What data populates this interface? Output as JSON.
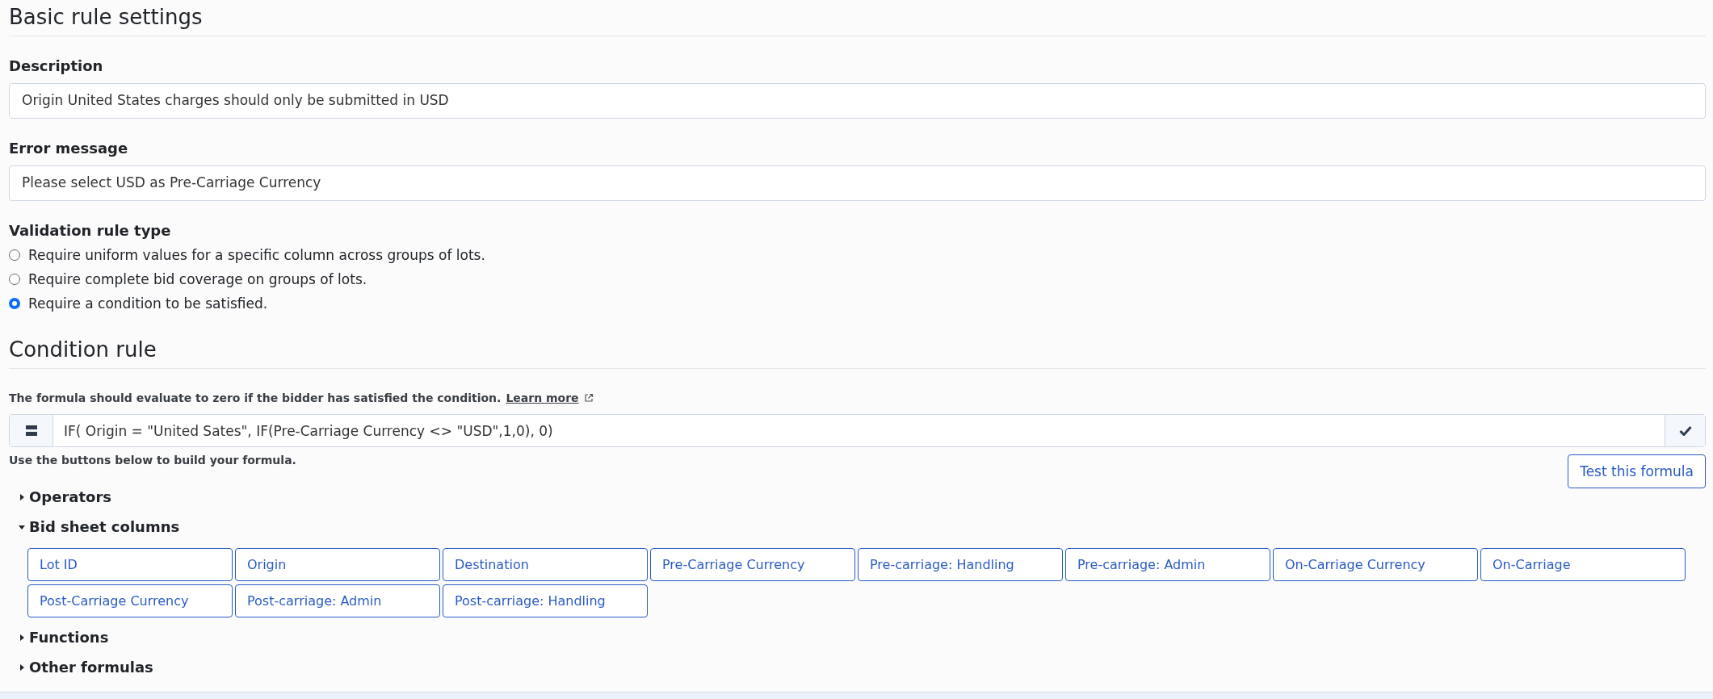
{
  "basic_settings": {
    "title": "Basic rule settings",
    "description": {
      "label": "Description",
      "value": "Origin United States charges should only be submitted in USD"
    },
    "error_message": {
      "label": "Error message",
      "value": "Please select USD as Pre-Carriage Currency"
    },
    "validation_rule_type": {
      "label": "Validation rule type",
      "options": [
        {
          "label": "Require uniform values for a specific column across groups of lots.",
          "selected": false
        },
        {
          "label": "Require complete bid coverage on groups of lots.",
          "selected": false
        },
        {
          "label": "Require a condition to be satisfied.",
          "selected": true
        }
      ]
    }
  },
  "condition_rule": {
    "title": "Condition rule",
    "hint": "The formula should evaluate to zero if the bidder has satisfied the condition.",
    "learn_more": "Learn more",
    "formula": "IF( Origin = \"United Sates\", IF(Pre-Carriage Currency <> \"USD\",1,0), 0)",
    "help": "Use the buttons below to build your formula.",
    "test_button": "Test this formula",
    "groups": [
      {
        "label": "Operators",
        "expanded": false
      },
      {
        "label": "Bid sheet columns",
        "expanded": true,
        "buttons": [
          "Lot ID",
          "Origin",
          "Destination",
          "Pre-Carriage Currency",
          "Pre-carriage: Handling",
          "Pre-carriage: Admin",
          "On-Carriage Currency",
          "On-Carriage",
          "Post-Carriage Currency",
          "Post-carriage: Admin",
          "Post-carriage: Handling"
        ]
      },
      {
        "label": "Functions",
        "expanded": false
      },
      {
        "label": "Other formulas",
        "expanded": false
      }
    ]
  }
}
